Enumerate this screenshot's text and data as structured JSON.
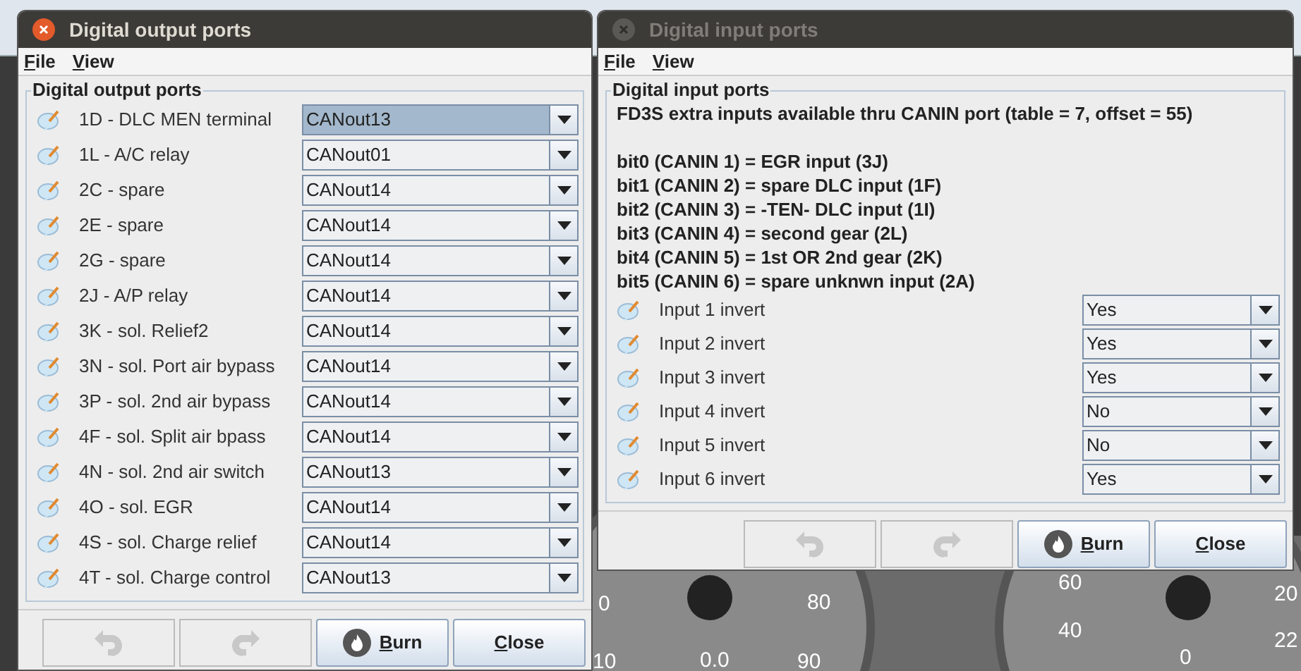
{
  "background": {
    "gauge_labels": [
      "0",
      "10",
      "80",
      "0.0",
      "90",
      "60",
      "40",
      "0",
      "20",
      "22"
    ]
  },
  "windows": [
    {
      "title": "Digital output ports",
      "active": true,
      "menu": [
        "File",
        "View"
      ],
      "panel_title": "Digital output ports",
      "rows": [
        {
          "label": "1D - DLC MEN terminal",
          "value": "CANout13",
          "focused": true
        },
        {
          "label": "1L - A/C relay",
          "value": "CANout01",
          "focused": false
        },
        {
          "label": "2C - spare",
          "value": "CANout14",
          "focused": false
        },
        {
          "label": "2E - spare",
          "value": "CANout14",
          "focused": false
        },
        {
          "label": "2G - spare",
          "value": "CANout14",
          "focused": false
        },
        {
          "label": "2J - A/P relay",
          "value": "CANout14",
          "focused": false
        },
        {
          "label": "3K - sol. Relief2",
          "value": "CANout14",
          "focused": false
        },
        {
          "label": "3N - sol. Port air bypass",
          "value": "CANout14",
          "focused": false
        },
        {
          "label": "3P - sol. 2nd air bypass",
          "value": "CANout14",
          "focused": false
        },
        {
          "label": "4F - sol. Split air bpass",
          "value": "CANout14",
          "focused": false
        },
        {
          "label": "4N - sol. 2nd air switch",
          "value": "CANout13",
          "focused": false
        },
        {
          "label": "4O - sol. EGR",
          "value": "CANout14",
          "focused": false
        },
        {
          "label": "4S - sol. Charge relief",
          "value": "CANout14",
          "focused": false
        },
        {
          "label": "4T - sol. Charge control",
          "value": "CANout13",
          "focused": false
        }
      ],
      "buttons": [
        {
          "kind": "undo",
          "disabled": true
        },
        {
          "kind": "redo",
          "disabled": true
        },
        {
          "kind": "burn",
          "label": "Burn",
          "disabled": false
        },
        {
          "kind": "close",
          "label": "Close",
          "disabled": false
        }
      ]
    },
    {
      "title": "Digital input ports",
      "active": false,
      "menu": [
        "File",
        "View"
      ],
      "panel_title": "Digital input ports",
      "header": "FD3S extra inputs available thru CANIN port (table = 7, offset = 55)",
      "notes": [
        "bit0 (CANIN 1) = EGR input (3J)",
        "bit1 (CANIN 2) = spare DLC input (1F)",
        "bit2 (CANIN 3) = -TEN- DLC input (1I)",
        "bit3 (CANIN 4) = second gear (2L)",
        "bit4 (CANIN 5) = 1st OR 2nd gear (2K)",
        "bit5 (CANIN 6) = spare unknwn input (2A)"
      ],
      "rows": [
        {
          "label": "Input 1 invert",
          "value": "Yes",
          "focused": false
        },
        {
          "label": "Input 2 invert",
          "value": "Yes",
          "focused": false
        },
        {
          "label": "Input 3 invert",
          "value": "Yes",
          "focused": false
        },
        {
          "label": "Input 4 invert",
          "value": "No",
          "focused": false
        },
        {
          "label": "Input 5 invert",
          "value": "No",
          "focused": false
        },
        {
          "label": "Input 6 invert",
          "value": "Yes",
          "focused": false
        }
      ],
      "buttons": [
        {
          "kind": "undo",
          "disabled": true
        },
        {
          "kind": "redo",
          "disabled": true
        },
        {
          "kind": "burn",
          "label": "Burn",
          "disabled": false
        },
        {
          "kind": "close",
          "label": "Close",
          "disabled": false
        }
      ]
    }
  ]
}
